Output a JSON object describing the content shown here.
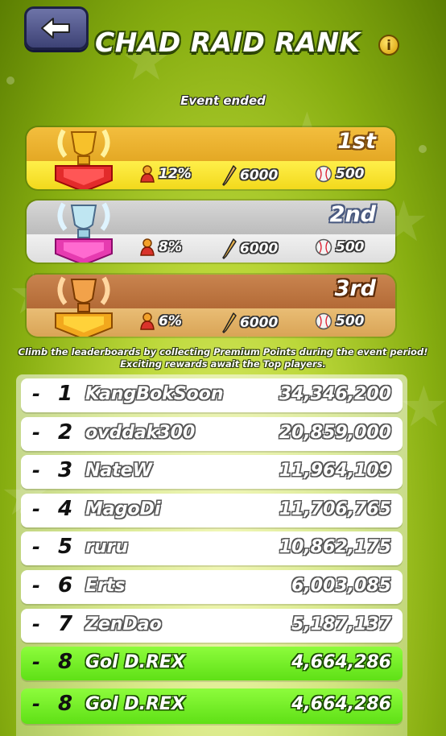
{
  "header": {
    "title": "CHAD RAID RANK",
    "back_icon": "arrow-left-icon",
    "info_label": "i",
    "event_status": "Event ended"
  },
  "rewards": [
    {
      "place": "1st",
      "medal": "1",
      "percent": "12%",
      "bats": "6000",
      "balls": "500"
    },
    {
      "place": "2nd",
      "medal": "2",
      "percent": "8%",
      "bats": "6000",
      "balls": "500"
    },
    {
      "place": "3rd",
      "medal": "3",
      "percent": "6%",
      "bats": "6000",
      "balls": "500"
    }
  ],
  "description": "Climb the leaderboards by collecting Premium Points during the event period! Exciting rewards await the Top players.",
  "leaderboard": [
    {
      "dash": "-",
      "rank": "1",
      "name": "KangBokSoon",
      "score": "34,346,200"
    },
    {
      "dash": "-",
      "rank": "2",
      "name": "ovddak300",
      "score": "20,859,000"
    },
    {
      "dash": "-",
      "rank": "3",
      "name": "NateW",
      "score": "11,964,109"
    },
    {
      "dash": "-",
      "rank": "4",
      "name": "MagoDi",
      "score": "11,706,765"
    },
    {
      "dash": "-",
      "rank": "5",
      "name": "ruru",
      "score": "10,862,175"
    },
    {
      "dash": "-",
      "rank": "6",
      "name": "Erts",
      "score": "6,003,085"
    },
    {
      "dash": "-",
      "rank": "7",
      "name": "ZenDao",
      "score": "5,187,137"
    },
    {
      "dash": "-",
      "rank": "8",
      "name": "Gol D.REX",
      "score": "4,664,286"
    }
  ],
  "my_rank": {
    "dash": "-",
    "rank": "8",
    "name": "Gol D.REX",
    "score": "4,664,286"
  },
  "colors": {
    "background": "#a6c61e",
    "gold_top": "#e9ae2b",
    "gold_bottom": "#f7e22a",
    "silver": "#c9c9c9",
    "bronze": "#c07a45",
    "highlight_row": "#76ee2a"
  }
}
